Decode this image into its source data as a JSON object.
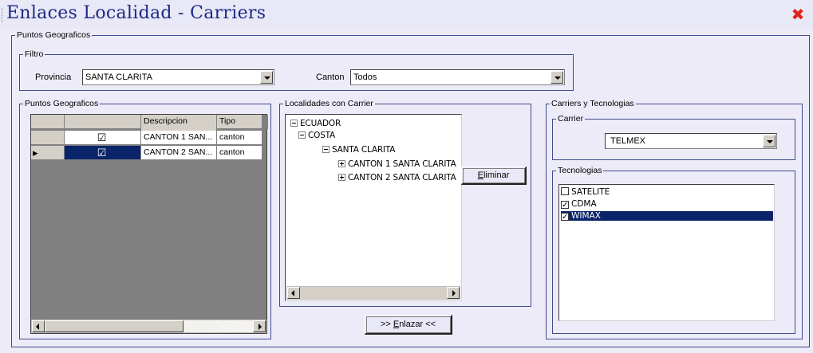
{
  "window": {
    "title": "Enlaces Localidad - Carriers",
    "close_glyph": "✖"
  },
  "puntos_group": {
    "legend": "Puntos Geograficos"
  },
  "filtro": {
    "legend": "Filtro",
    "provincia_label": "Provincia",
    "provincia_value": "SANTA CLARITA",
    "canton_label": "Canton",
    "canton_value": "Todos"
  },
  "puntos_grid": {
    "legend": "Puntos Geograficos",
    "columns": [
      "",
      "",
      "Descripcion",
      "Tipo"
    ],
    "rows": [
      {
        "selector": "",
        "checked": "☑",
        "descripcion": "CANTON 1 SAN...",
        "tipo": "canton"
      },
      {
        "selector": "▸",
        "checked": "☑",
        "descripcion": "CANTON 2 SAN...",
        "tipo": "canton"
      }
    ]
  },
  "localidades": {
    "legend": "Localidades con Carrier",
    "tree": [
      {
        "label": "ECUADOR",
        "expander": "minus"
      },
      {
        "label": "COSTA",
        "expander": "minus"
      },
      {
        "label": "SANTA CLARITA",
        "expander": "minus"
      },
      {
        "label": "CANTON 1 SANTA CLARITA",
        "expander": "plus"
      },
      {
        "label": "CANTON 2 SANTA CLARITA",
        "expander": "plus"
      }
    ],
    "eliminar_button": "Eliminar",
    "enlazar_button": ">> Enlazar <<"
  },
  "carriers": {
    "legend": "Carriers y Tecnologias",
    "carrier_legend": "Carrier",
    "carrier_value": "TELMEX",
    "tecnologias_legend": "Tecnologias",
    "tecnologias": [
      {
        "label": "SATELITE",
        "checked": false
      },
      {
        "label": "CDMA",
        "checked": true
      },
      {
        "label": "WIMAX",
        "checked": true,
        "selected": true
      }
    ]
  },
  "colors": {
    "title": "#1c2a86",
    "selection": "#0a246a",
    "close": "#e2231a",
    "background": "#ecebf7"
  }
}
